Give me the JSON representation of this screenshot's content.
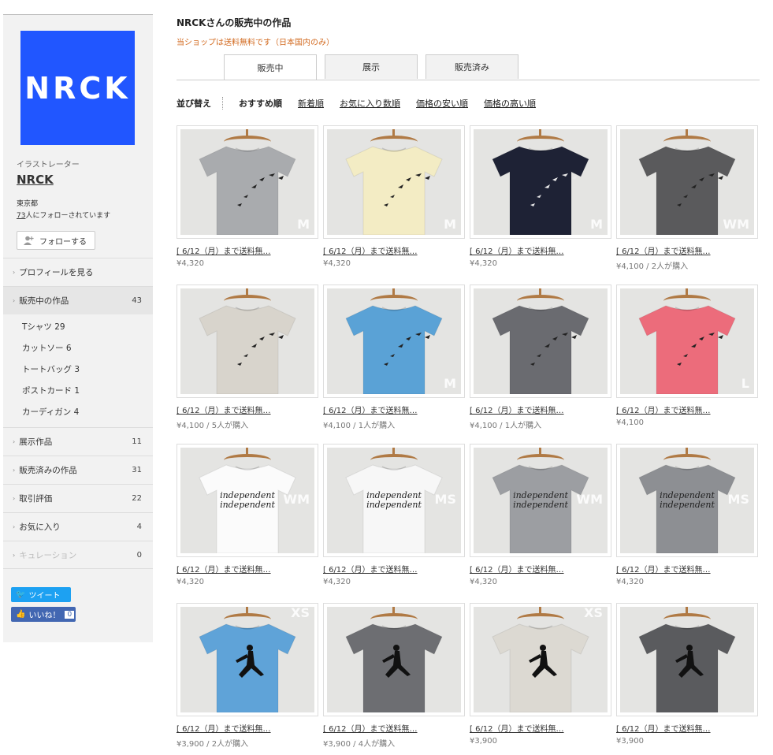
{
  "sidebar": {
    "logo_text": "NRCK",
    "role": "イラストレーター",
    "shop_name": "NRCK",
    "location": "東京都",
    "followers_count": "73",
    "followers_text": "人にフォローされています",
    "follow_button": "フォローする",
    "menu": [
      {
        "label": "プロフィールを見る",
        "count": ""
      },
      {
        "label": "販売中の作品",
        "count": "43"
      },
      {
        "label": "展示作品",
        "count": "11"
      },
      {
        "label": "販売済みの作品",
        "count": "31"
      },
      {
        "label": "取引評価",
        "count": "22"
      },
      {
        "label": "お気に入り",
        "count": "4"
      },
      {
        "label": "キュレーション",
        "count": "0"
      }
    ],
    "subcategories": [
      {
        "label": "Tシャツ  29"
      },
      {
        "label": "カットソー  6"
      },
      {
        "label": "トートバッグ  3"
      },
      {
        "label": "ポストカード  1"
      },
      {
        "label": "カーディガン  4"
      }
    ],
    "share": {
      "tweet": "ツイート",
      "like": "いいね！",
      "like_count": "0"
    }
  },
  "main": {
    "title": "NRCKさんの販売中の作品",
    "shipping_note": "当ショップは送料無料です（日本国内のみ）",
    "tabs": [
      "販売中",
      "展示",
      "販売済み"
    ],
    "sort_label": "並び替え",
    "sort_options": [
      "おすすめ順",
      "新着順",
      "お気に入り数順",
      "価格の安い順",
      "価格の高い順"
    ],
    "items": [
      {
        "title": "[ 6/12（月）まで送料無…",
        "price": "¥4,320",
        "shirt_color": "#a9abae",
        "design": "birds",
        "size": "M"
      },
      {
        "title": "[ 6/12（月）まで送料無…",
        "price": "¥4,320",
        "shirt_color": "#f3ecc4",
        "design": "birds",
        "size": "M"
      },
      {
        "title": "[ 6/12（月）まで送料無…",
        "price": "¥4,320",
        "shirt_color": "#1e2235",
        "design": "birds",
        "size": "M"
      },
      {
        "title": "[ 6/12（月）まで送料無…",
        "price": "¥4,100 / 2人が購入",
        "shirt_color": "#5a5a5c",
        "design": "birds",
        "size": "WM"
      },
      {
        "title": "[ 6/12（月）まで送料無…",
        "price": "¥4,100 / 5人が購入",
        "shirt_color": "#d8d4cc",
        "design": "birds",
        "size": ""
      },
      {
        "title": "[ 6/12（月）まで送料無…",
        "price": "¥4,100 / 1人が購入",
        "shirt_color": "#5aa2d6",
        "design": "birds",
        "size": "M"
      },
      {
        "title": "[ 6/12（月）まで送料無…",
        "price": "¥4,100 / 1人が購入",
        "shirt_color": "#6a6b70",
        "design": "birds",
        "size": ""
      },
      {
        "title": "[ 6/12（月）まで送料無…",
        "price": "¥4,100",
        "shirt_color": "#ec6c7b",
        "design": "birds",
        "size": "L"
      },
      {
        "title": "[ 6/12（月）まで送料無…",
        "price": "¥4,320",
        "shirt_color": "#fbfbfb",
        "design": "text",
        "size": "WM"
      },
      {
        "title": "[ 6/12（月）まで送料無…",
        "price": "¥4,320",
        "shirt_color": "#f7f7f7",
        "design": "text",
        "size": "MS"
      },
      {
        "title": "[ 6/12（月）まで送料無…",
        "price": "¥4,320",
        "shirt_color": "#9c9ea2",
        "design": "text",
        "size": "WM"
      },
      {
        "title": "[ 6/12（月）まで送料無…",
        "price": "¥4,320",
        "shirt_color": "#8d8f93",
        "design": "text",
        "size": "MS"
      },
      {
        "title": "[ 6/12（月）まで送料無…",
        "price": "¥3,900 / 2人が購入",
        "shirt_color": "#5fa3d8",
        "design": "runner",
        "size": "XS"
      },
      {
        "title": "[ 6/12（月）まで送料無…",
        "price": "¥3,900 / 4人が購入",
        "shirt_color": "#6d6e72",
        "design": "runner",
        "size": ""
      },
      {
        "title": "[ 6/12（月）まで送料無…",
        "price": "¥3,900",
        "shirt_color": "#dcd9d2",
        "design": "runner",
        "size": "XS"
      },
      {
        "title": "[ 6/12（月）まで送料無…",
        "price": "¥3,900",
        "shirt_color": "#5a5b5e",
        "design": "runner",
        "size": ""
      }
    ],
    "text_design": "independent"
  }
}
